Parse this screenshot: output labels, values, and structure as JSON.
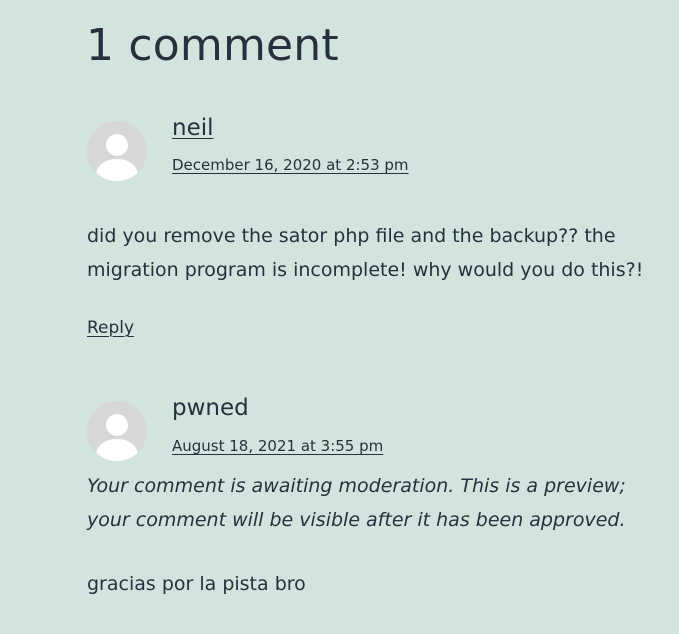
{
  "comments_section": {
    "title": "1 comment",
    "comments": [
      {
        "author": "neil",
        "author_is_link": true,
        "date": "December 16, 2020 at 2:53 pm",
        "text": "did you remove the sator php file and the backup?? the migration program is incomplete! why would you do this?!",
        "reply_label": "Reply",
        "avatar_icon": "default-user-avatar-icon"
      },
      {
        "author": "pwned",
        "author_is_link": false,
        "date": "August 18, 2021 at 3:55 pm",
        "moderation_notice": "Your comment is awaiting moderation. This is a preview; your comment will be visible after it has been approved.",
        "text": "gracias por la pista bro",
        "avatar_icon": "default-user-avatar-icon"
      }
    ]
  },
  "colors": {
    "background": "#d1e4dd",
    "text": "#28303d",
    "avatar_bg": "#d7d7d7",
    "avatar_figure": "#ffffff"
  }
}
